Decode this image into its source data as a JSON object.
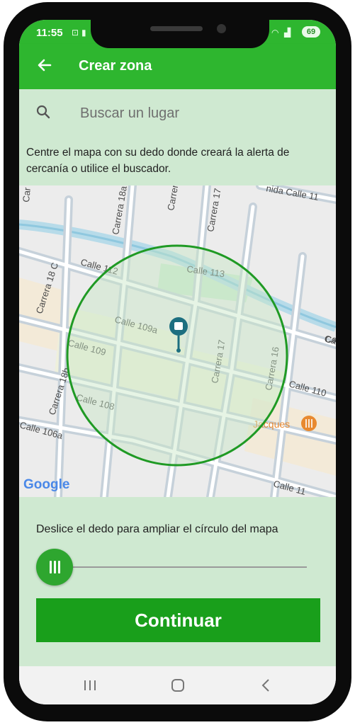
{
  "status": {
    "time": "11:55",
    "battery": "69"
  },
  "appbar": {
    "title": "Crear zona"
  },
  "search": {
    "placeholder": "Buscar un lugar"
  },
  "instructions": "Centre el mapa con su dedo donde creará la alerta de cercanía o utilice el buscador.",
  "map": {
    "labels": [
      "Calle 112",
      "Calle 113",
      "Calle 109a",
      "Calle 109",
      "Calle 108",
      "Calle 110",
      "Calle 106a",
      "Calle 11",
      "Calle 11",
      "Carrera 18a",
      "Carrera 17",
      "Carrera 17",
      "Carrera 18 C",
      "Carrera 18b",
      "Carrera 17",
      "Carrera 16",
      "Jacques",
      "nida Calle 11",
      "Car",
      "Ca"
    ],
    "logo": "Google",
    "colors": {
      "accent": "#2eb62f",
      "circle": "#1f9a24",
      "pin": "#1d6f80",
      "poi": "#e8892f"
    }
  },
  "slider": {
    "text": "Deslice el dedo para ampliar el círculo del mapa",
    "value": 0
  },
  "continue_label": "Continuar",
  "icons": {
    "back": "arrow-back-icon",
    "search": "search-icon",
    "pin": "bus-stop-pin-icon",
    "poi": "restaurant-icon"
  }
}
